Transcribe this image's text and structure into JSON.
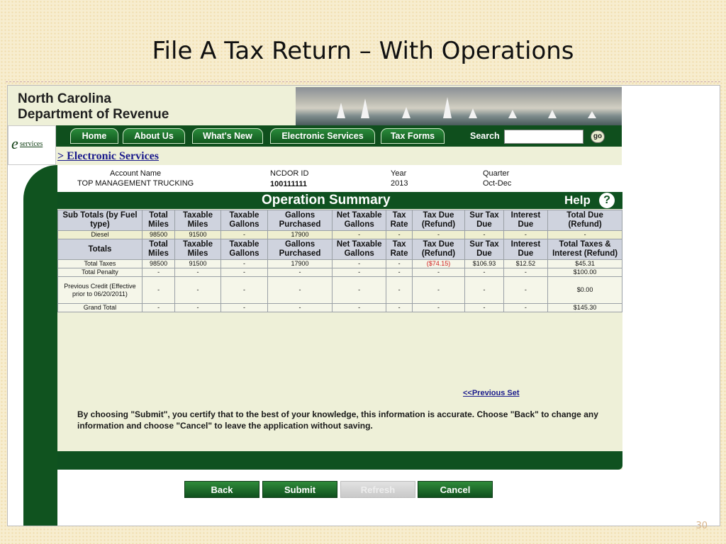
{
  "slide": {
    "title": "File A Tax Return – With Operations",
    "page_number": "30"
  },
  "header": {
    "org_line1": "North Carolina",
    "org_line2": "Department of Revenue"
  },
  "eservices": {
    "e": "e",
    "label": "services"
  },
  "nav": {
    "tabs": [
      "Home",
      "About Us",
      "What's New",
      "Electronic Services",
      "Tax Forms"
    ],
    "search_label": "Search",
    "go_label": "go"
  },
  "breadcrumb": "> Electronic Services",
  "account": {
    "name_label": "Account Name",
    "name_value": "TOP MANAGEMENT TRUCKING",
    "id_label": "NCDOR ID",
    "id_value": "100111111",
    "year_label": "Year",
    "year_value": "2013",
    "quarter_label": "Quarter",
    "quarter_value": "Oct-Dec"
  },
  "summary": {
    "title": "Operation Summary",
    "help_label": "Help",
    "help_icon": "?"
  },
  "subtotals_headers": [
    "Sub Totals (by Fuel type)",
    "Total Miles",
    "Taxable Miles",
    "Taxable Gallons",
    "Gallons Purchased",
    "Net Taxable Gallons",
    "Tax Rate",
    "Tax Due (Refund)",
    "Sur Tax Due",
    "Interest Due",
    "Total Due (Refund)"
  ],
  "subtotals_rows": [
    [
      "Diesel",
      "98500",
      "91500",
      "-",
      "17900",
      "-",
      "-",
      "-",
      "-",
      "-",
      "-"
    ]
  ],
  "totals_headers": [
    "Totals",
    "Total Miles",
    "Taxable Miles",
    "Taxable Gallons",
    "Gallons Purchased",
    "Net Taxable Gallons",
    "Tax Rate",
    "Tax Due (Refund)",
    "Sur Tax Due",
    "Interest Due",
    "Total Taxes & Interest (Refund)"
  ],
  "totals_rows": [
    [
      "Total Taxes",
      "98500",
      "91500",
      "-",
      "17900",
      "-",
      "-",
      "($74.15)",
      "$106.93",
      "$12.52",
      "$45.31"
    ],
    [
      "Total Penalty",
      "-",
      "-",
      "-",
      "-",
      "-",
      "-",
      "-",
      "-",
      "-",
      "$100.00"
    ],
    [
      "Previous Credit (Effective prior to 06/20/2011)",
      "-",
      "-",
      "-",
      "-",
      "-",
      "-",
      "-",
      "-",
      "-",
      "$0.00"
    ],
    [
      "Grand Total",
      "-",
      "-",
      "-",
      "-",
      "-",
      "-",
      "-",
      "-",
      "-",
      "$145.30"
    ]
  ],
  "previous_link": "<<Previous Set",
  "notice": "By choosing \"Submit\", you certify that to the best of your knowledge, this information is accurate. Choose \"Back\" to change any information and choose \"Cancel\" to leave the application without saving.",
  "buttons": {
    "back": "Back",
    "submit": "Submit",
    "refresh": "Refresh",
    "cancel": "Cancel"
  },
  "colors": {
    "nav_green": "#0f5120",
    "panel": "#eef0d8",
    "header_cell": "#cfd3de",
    "refund_red": "#d02020"
  }
}
